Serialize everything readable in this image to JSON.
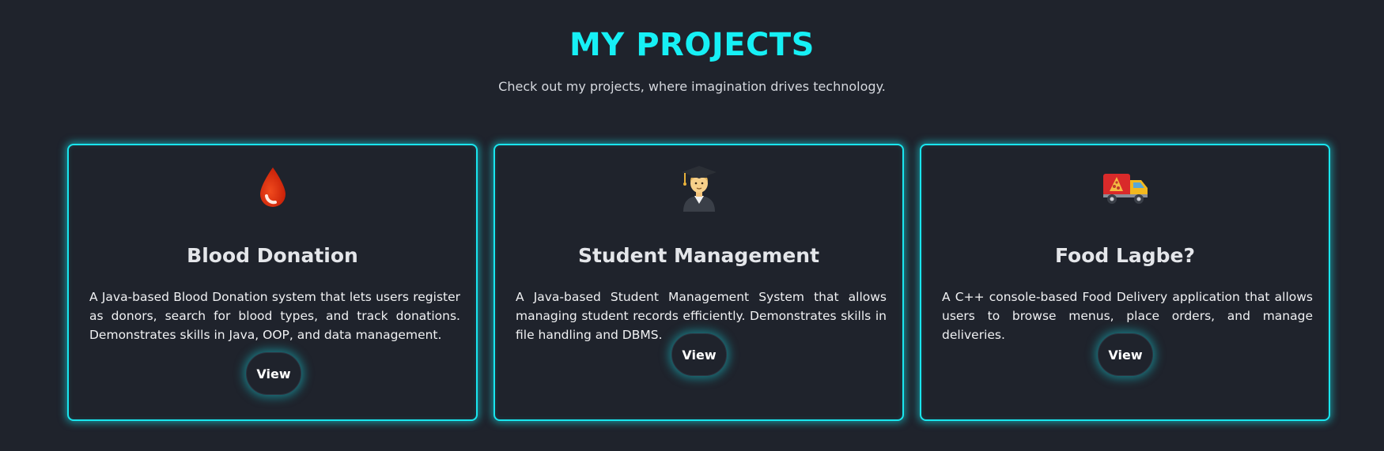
{
  "header": {
    "title": "MY PROJECTS",
    "subtitle": "Check out my projects, where imagination drives technology."
  },
  "projects": [
    {
      "icon": "blood-drop-icon",
      "title": "Blood Donation",
      "description": "A Java-based Blood Donation system that lets users register as donors, search for blood types, and track donations. Demonstrates skills in Java, OOP, and data management.",
      "button_label": "View"
    },
    {
      "icon": "student-graduate-icon",
      "title": "Student Management",
      "description": "A Java-based Student Management System that allows managing student records efficiently. Demonstrates skills in file handling and DBMS.",
      "button_label": "View"
    },
    {
      "icon": "delivery-truck-icon",
      "title": "Food Lagbe?",
      "description": "A C++ console-based Food Delivery application that allows users to browse menus, place orders, and manage deliveries.",
      "button_label": "View"
    }
  ],
  "colors": {
    "background": "#1f232c",
    "accent": "#16f0f5",
    "text": "#e4e6ea"
  }
}
